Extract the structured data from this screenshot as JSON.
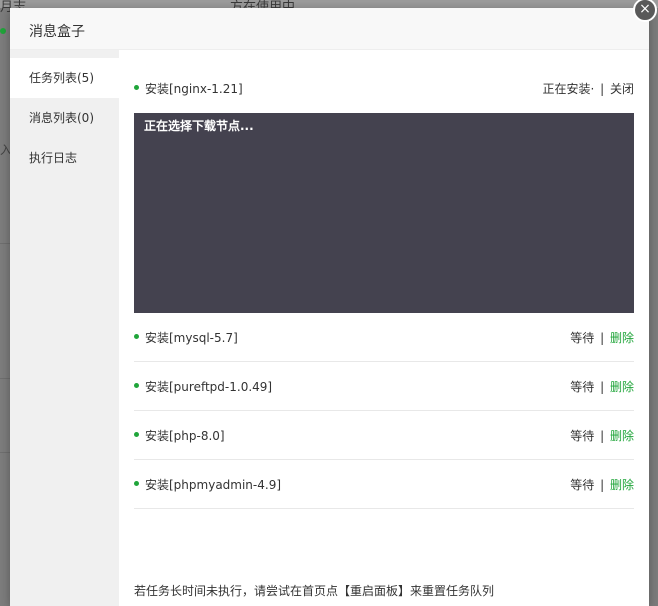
{
  "background": {
    "top_left_text": "月志",
    "top_center_text": "方在使用中",
    "side_char": "入"
  },
  "modal": {
    "title": "消息盒子",
    "close_icon": "×"
  },
  "sidebar": {
    "items": [
      {
        "label": "任务列表(5)",
        "active": true
      },
      {
        "label": "消息列表(0)",
        "active": false
      },
      {
        "label": "执行日志",
        "active": false
      }
    ]
  },
  "current_task": {
    "name": "安装[nginx-1.21]",
    "status": "正在安装·",
    "separator": "|",
    "close_label": "关闭",
    "console_text": "正在选择下载节点..."
  },
  "queued_tasks": [
    {
      "name": "安装[mysql-5.7]",
      "status": "等待",
      "separator": "|",
      "delete_label": "删除"
    },
    {
      "name": "安装[pureftpd-1.0.49]",
      "status": "等待",
      "separator": "|",
      "delete_label": "删除"
    },
    {
      "name": "安装[php-8.0]",
      "status": "等待",
      "separator": "|",
      "delete_label": "删除"
    },
    {
      "name": "安装[phpmyadmin-4.9]",
      "status": "等待",
      "separator": "|",
      "delete_label": "删除"
    }
  ],
  "footer_note": "若任务长时间未执行，请尝试在首页点【重启面板】来重置任务队列",
  "colors": {
    "accent": "#20a53a",
    "console_bg": "#44424f",
    "sidebar_bg": "#f0f0f0"
  }
}
